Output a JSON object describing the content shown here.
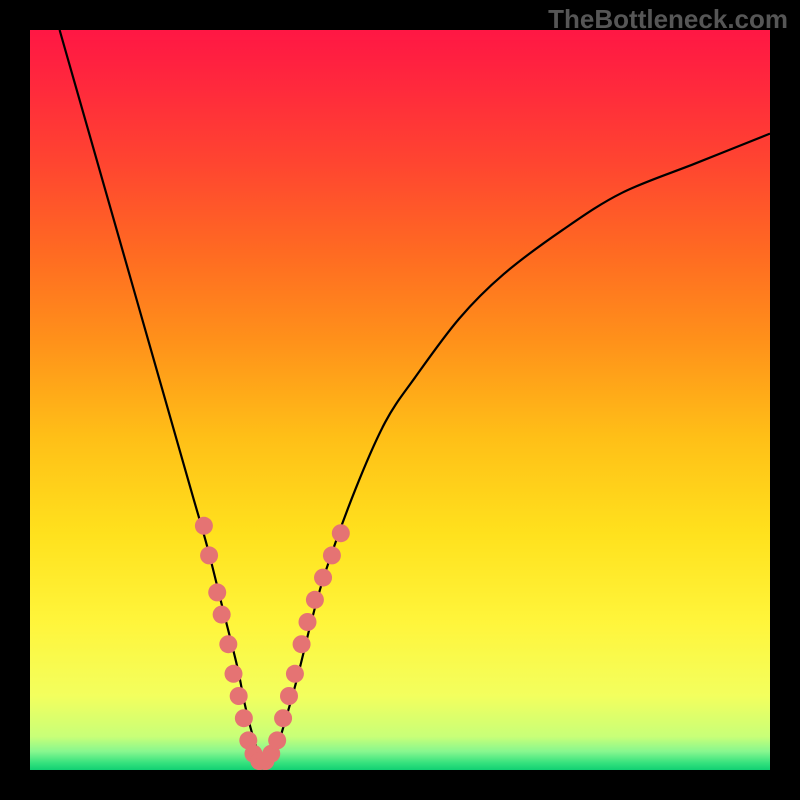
{
  "watermark": "TheBottleneck.com",
  "chart_data": {
    "type": "line",
    "title": "",
    "xlabel": "",
    "ylabel": "",
    "xlim": [
      0,
      100
    ],
    "ylim": [
      0,
      100
    ],
    "legend": null,
    "background": {
      "type": "vertical-gradient",
      "stops": [
        {
          "offset": 0.0,
          "color": "#ff1744"
        },
        {
          "offset": 0.08,
          "color": "#ff2a3c"
        },
        {
          "offset": 0.18,
          "color": "#ff4530"
        },
        {
          "offset": 0.3,
          "color": "#ff6a22"
        },
        {
          "offset": 0.42,
          "color": "#ff911a"
        },
        {
          "offset": 0.55,
          "color": "#ffbf17"
        },
        {
          "offset": 0.68,
          "color": "#ffe11d"
        },
        {
          "offset": 0.8,
          "color": "#fff53b"
        },
        {
          "offset": 0.9,
          "color": "#f3ff5e"
        },
        {
          "offset": 0.955,
          "color": "#c8ff78"
        },
        {
          "offset": 0.975,
          "color": "#87f78f"
        },
        {
          "offset": 0.99,
          "color": "#37e27e"
        },
        {
          "offset": 1.0,
          "color": "#11d073"
        }
      ]
    },
    "series": [
      {
        "name": "curve",
        "color": "#000000",
        "x": [
          4,
          6,
          8,
          10,
          12,
          14,
          16,
          18,
          20,
          22,
          24,
          26,
          28,
          29,
          30,
          31,
          32,
          33,
          34,
          36,
          38,
          40,
          44,
          48,
          52,
          58,
          64,
          72,
          80,
          90,
          100
        ],
        "y": [
          100,
          93,
          86,
          79,
          72,
          65,
          58,
          51,
          44,
          37,
          30,
          22,
          14,
          9,
          5,
          2,
          1,
          2,
          5,
          12,
          20,
          27,
          38,
          47,
          53,
          61,
          67,
          73,
          78,
          82,
          86
        ]
      }
    ],
    "markers": {
      "name": "highlight-dots",
      "color": "#e57373",
      "radius": 9,
      "points": [
        {
          "x": 23.5,
          "y": 33
        },
        {
          "x": 24.2,
          "y": 29
        },
        {
          "x": 25.3,
          "y": 24
        },
        {
          "x": 25.9,
          "y": 21
        },
        {
          "x": 26.8,
          "y": 17
        },
        {
          "x": 27.5,
          "y": 13
        },
        {
          "x": 28.2,
          "y": 10
        },
        {
          "x": 28.9,
          "y": 7
        },
        {
          "x": 29.5,
          "y": 4
        },
        {
          "x": 30.2,
          "y": 2.2
        },
        {
          "x": 31.0,
          "y": 1.2
        },
        {
          "x": 31.8,
          "y": 1.2
        },
        {
          "x": 32.6,
          "y": 2.2
        },
        {
          "x": 33.4,
          "y": 4
        },
        {
          "x": 34.2,
          "y": 7
        },
        {
          "x": 35.0,
          "y": 10
        },
        {
          "x": 35.8,
          "y": 13
        },
        {
          "x": 36.7,
          "y": 17
        },
        {
          "x": 37.5,
          "y": 20
        },
        {
          "x": 38.5,
          "y": 23
        },
        {
          "x": 39.6,
          "y": 26
        },
        {
          "x": 40.8,
          "y": 29
        },
        {
          "x": 42.0,
          "y": 32
        }
      ]
    }
  }
}
